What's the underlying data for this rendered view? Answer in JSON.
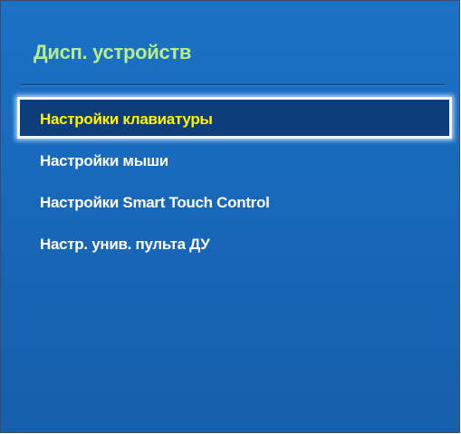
{
  "panel": {
    "title": "Дисп. устройств",
    "colors": {
      "background": "#1a6dc0",
      "title": "#b5ee88",
      "selected_text": "#fff400",
      "selected_background": "#0d3e7b",
      "item_text": "#ffffff"
    }
  },
  "menu": {
    "selected_index": 0,
    "items": [
      {
        "label": "Настройки клавиатуры"
      },
      {
        "label": "Настройки мыши"
      },
      {
        "label": "Настройки Smart Touch Control"
      },
      {
        "label": "Настр. унив. пульта ДУ"
      }
    ]
  }
}
